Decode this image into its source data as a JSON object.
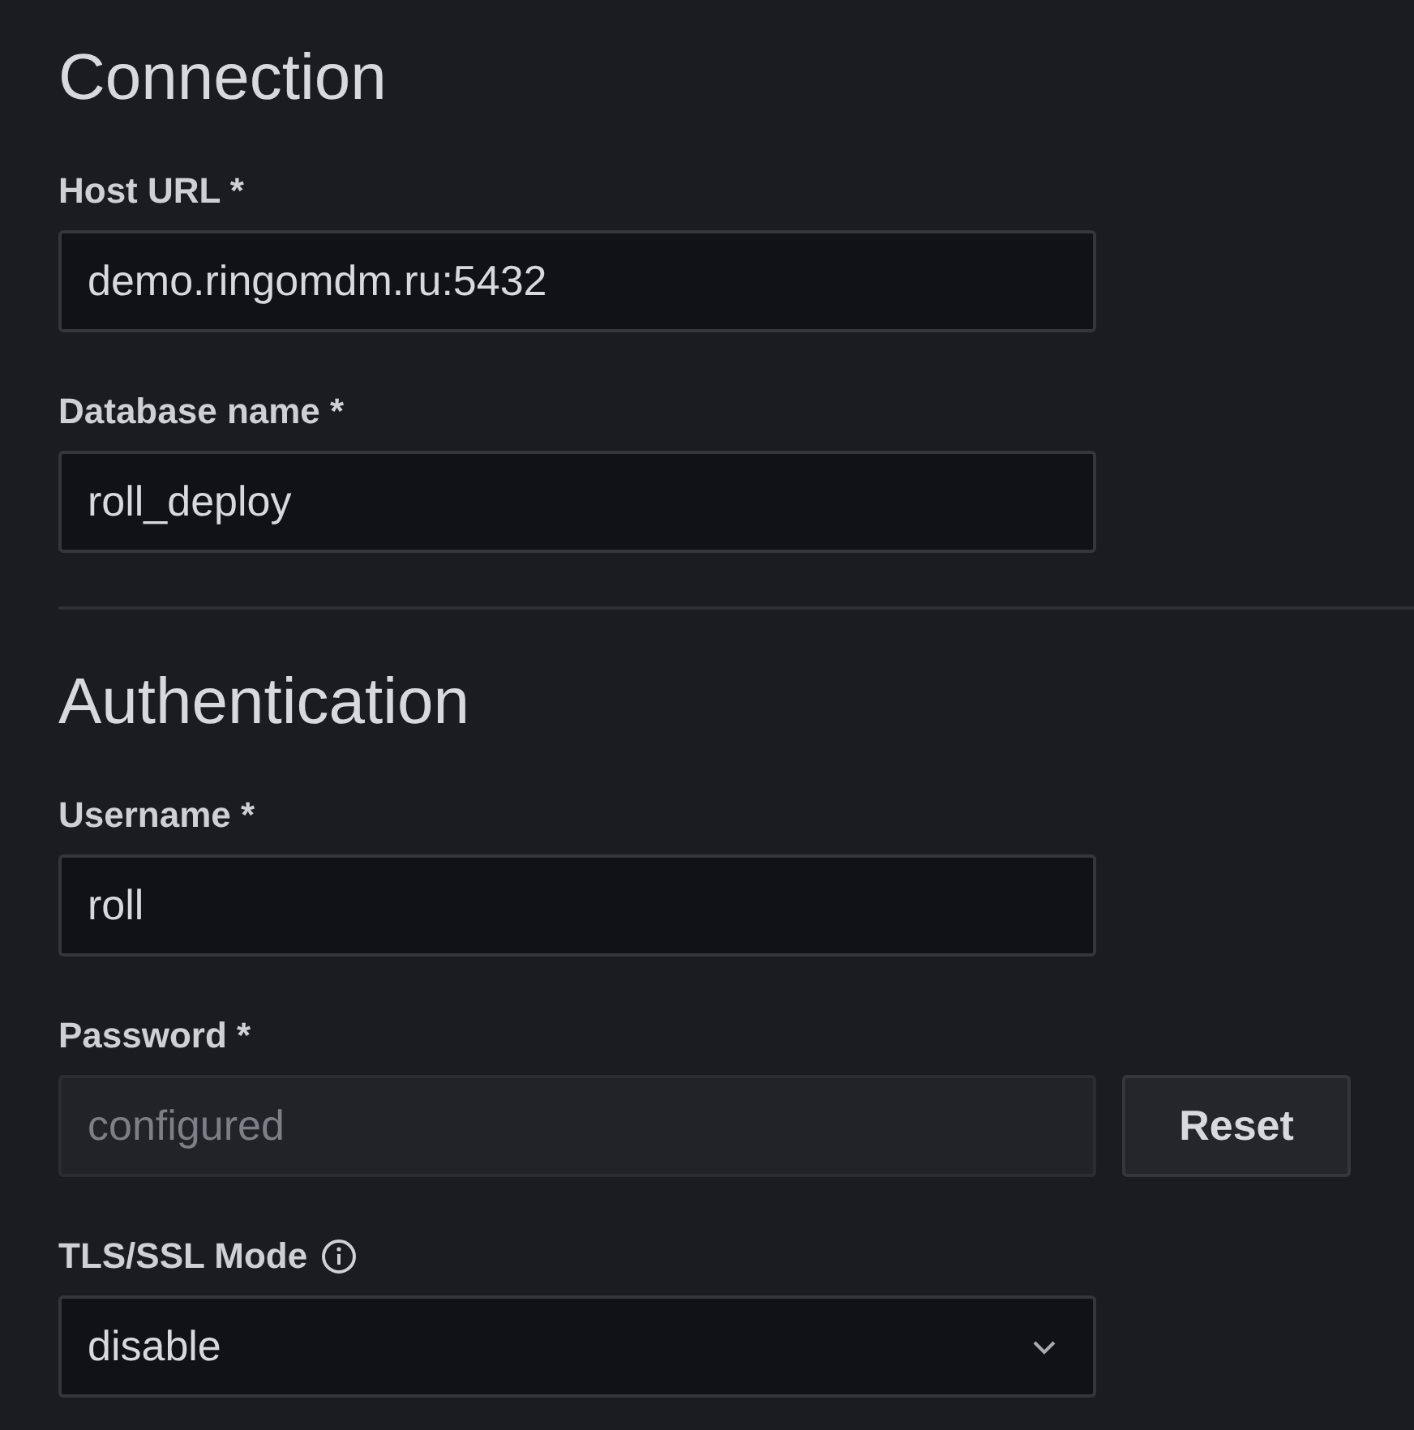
{
  "sections": [
    {
      "title": "Connection",
      "fields": [
        {
          "kind": "text",
          "label": "Host URL *",
          "value": "demo.ringomdm.ru:5432"
        },
        {
          "kind": "text",
          "label": "Database name *",
          "value": "roll_deploy"
        }
      ]
    },
    {
      "title": "Authentication",
      "fields": [
        {
          "kind": "text",
          "label": "Username *",
          "value": "roll"
        },
        {
          "kind": "configured",
          "label": "Password *",
          "placeholder": "configured",
          "disabled": true,
          "button": "Reset"
        },
        {
          "kind": "select",
          "label": "TLS/SSL Mode",
          "info": true,
          "value": "disable"
        }
      ]
    }
  ]
}
